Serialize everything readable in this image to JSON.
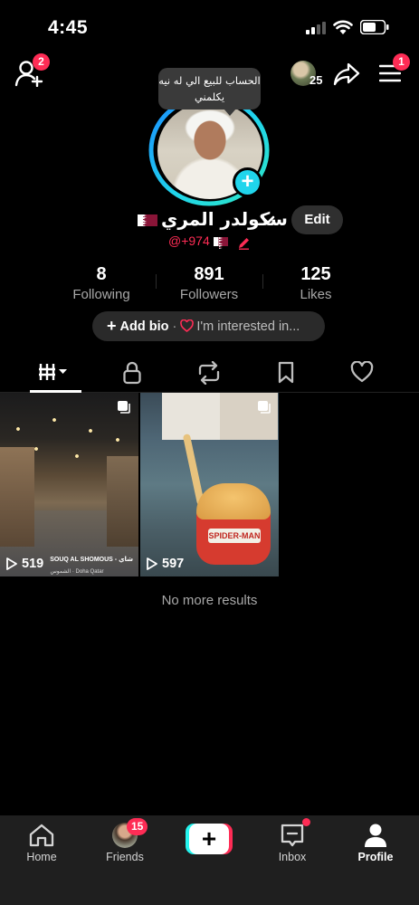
{
  "status_bar": {
    "time": "4:45"
  },
  "header": {
    "friend_requests_badge": "2",
    "viewer_count": "25",
    "menu_badge": "1"
  },
  "profile": {
    "tooltip": "الحساب للبيع الي له نيه يكلمني",
    "display_name": "سكولدر المري",
    "username": "@+974",
    "edit_label": "Edit"
  },
  "stats": [
    {
      "value": "8",
      "label": "Following"
    },
    {
      "value": "891",
      "label": "Followers"
    },
    {
      "value": "125",
      "label": "Likes"
    }
  ],
  "bio": {
    "add_bio": "Add bio",
    "separator": "·",
    "interest": "I'm interested in..."
  },
  "tabs": [
    {
      "icon": "grid-icon",
      "active": true
    },
    {
      "icon": "lock-icon",
      "active": false
    },
    {
      "icon": "repost-icon",
      "active": false
    },
    {
      "icon": "bookmark-icon",
      "active": false
    },
    {
      "icon": "heart-icon",
      "active": false
    }
  ],
  "videos": [
    {
      "views": "519",
      "caption": "SOUQ AL SHOMOUS - شاي",
      "caption_sub": "الشموس · Doha Qatar"
    },
    {
      "views": "597",
      "cup_label": "SPIDER-MAN"
    }
  ],
  "no_more_results": "No more results",
  "bottom_nav": {
    "home": "Home",
    "friends": "Friends",
    "friends_badge": "15",
    "create": "+",
    "inbox": "Inbox",
    "profile": "Profile"
  },
  "colors": {
    "accent_red": "#fe2c55",
    "accent_cyan": "#25f4ee",
    "background": "#000000",
    "pill_bg": "#2a2a2a"
  }
}
